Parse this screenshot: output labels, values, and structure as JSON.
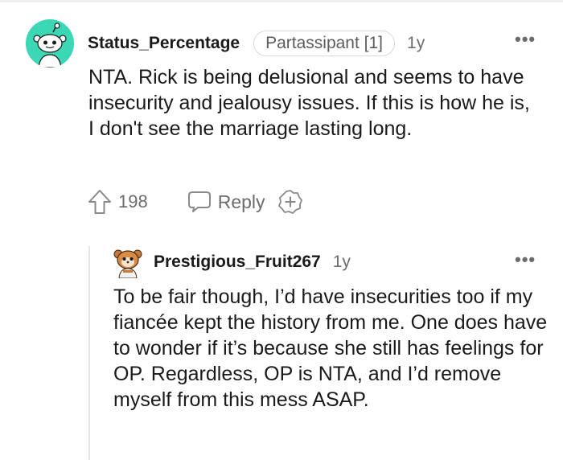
{
  "comments": [
    {
      "username": "Status_Percentage",
      "flair": "Partassipant [1]",
      "age": "1y",
      "more": "•••",
      "body": "NTA. Rick is being delusional and seems to have insecurity and jealousy issues. If this is how he is, I don't see the marriage lasting long.",
      "upvotes": "198",
      "reply_label": "Reply",
      "avatar_color": "#3cd8b5",
      "icons": [
        "snoo-avatar",
        "upvote-arrow-icon",
        "reply-bubble-icon",
        "award-plus-icon",
        "more-options-icon"
      ]
    },
    {
      "username": "Prestigious_Fruit267",
      "age": "1y",
      "more": "•••",
      "body": "To be fair though, I’d have insecurities too if my fiancée kept the history from me. One does have to wonder if it’s because she still has feelings for OP. Regardless, OP is NTA, and I’d remove myself from this mess ASAP.",
      "icons": [
        "snoo-avatar",
        "more-options-icon"
      ]
    }
  ],
  "colors": {
    "text": "#1a1a1b",
    "meta": "#6a6c6e",
    "flair_border": "#d7dadc",
    "thread_line": "#e4e6e8"
  }
}
